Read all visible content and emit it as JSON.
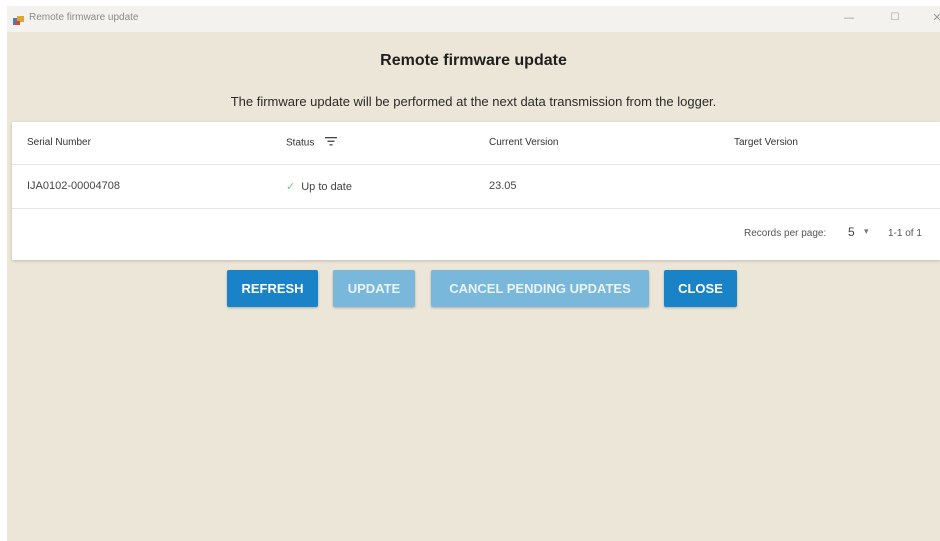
{
  "window": {
    "title": "Remote firmware update",
    "controls": {
      "minimize": "—",
      "maximize": "☐",
      "close": "✕"
    }
  },
  "header": {
    "title": "Remote firmware update",
    "subtitle": "The firmware update will be performed at the next data transmission from the logger."
  },
  "table": {
    "columns": [
      "Serial Number",
      "Status",
      "Current Version",
      "Target Version"
    ],
    "rows": [
      {
        "serial": "IJA0102-00004708",
        "status": "Up to date",
        "current_version": "23.05",
        "target_version": ""
      }
    ],
    "pagination": {
      "label": "Records per page:",
      "per_page": "5",
      "range": "1-1 of 1"
    }
  },
  "buttons": {
    "refresh": "REFRESH",
    "update": "UPDATE",
    "cancel_pending": "CANCEL PENDING UPDATES",
    "close": "CLOSE"
  },
  "icons": {
    "app": "app-icon",
    "filter": "filter-icon",
    "status_ok": "check-icon"
  },
  "colors": {
    "background": "#ece6d8",
    "primary_button": "#1a83c7",
    "disabled_button": "#7ab8db",
    "check": "#7cc47c"
  }
}
